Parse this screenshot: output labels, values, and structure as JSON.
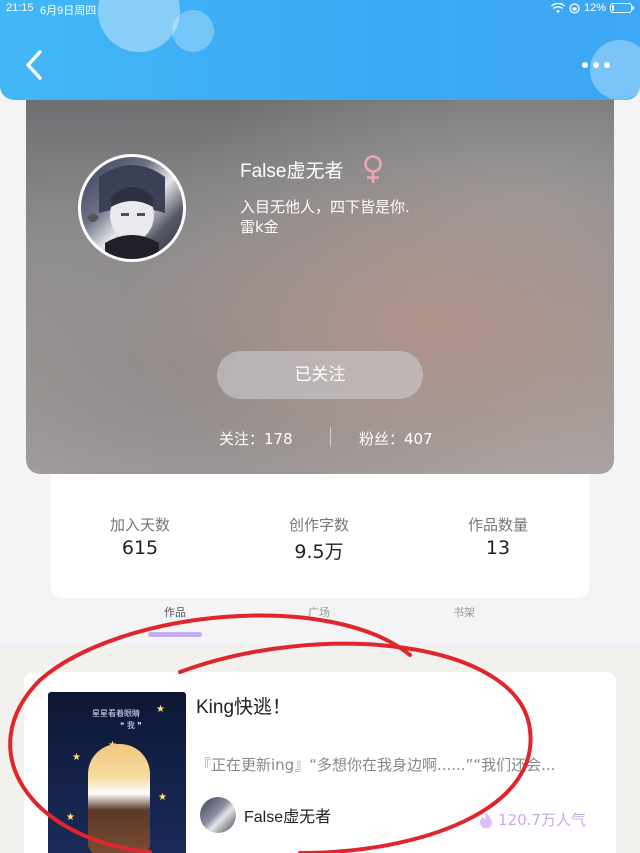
{
  "status_bar": {
    "time": "21:15",
    "date": "6月9日周四",
    "battery": "12%"
  },
  "header": {
    "back_icon": "chevron-left-icon",
    "more_icon": "more-horizontal-icon",
    "accent_color": "#3aa9f4"
  },
  "profile": {
    "name": "False虚无者",
    "gender_icon": "female-icon",
    "gender_color": "#e9a7b6",
    "bio_line1": "入目无他人，四下皆是你.",
    "bio_line2": "雷k金",
    "follow_button": "已关注",
    "following_label": "关注：178",
    "fans_label": "粉丝：407"
  },
  "summary": {
    "join_days_label": "加入天数",
    "join_days_value": "615",
    "words_label": "创作字数",
    "words_value": "9.5万",
    "works_label": "作品数量",
    "works_value": "13"
  },
  "tabs": [
    {
      "label": "作品",
      "active": true
    },
    {
      "label": "广场",
      "active": false
    },
    {
      "label": "书架",
      "active": false
    }
  ],
  "work": {
    "title": "King快逃！",
    "description": "『正在更新ing』“多想你在我身边啊......”“我们还会...",
    "author": "False虚无者",
    "popularity": "120.7万人气",
    "popularity_color": "#c9a8f3",
    "cover_line1": "星星看着眼睛",
    "cover_line2": "❝ 我 ❞"
  }
}
